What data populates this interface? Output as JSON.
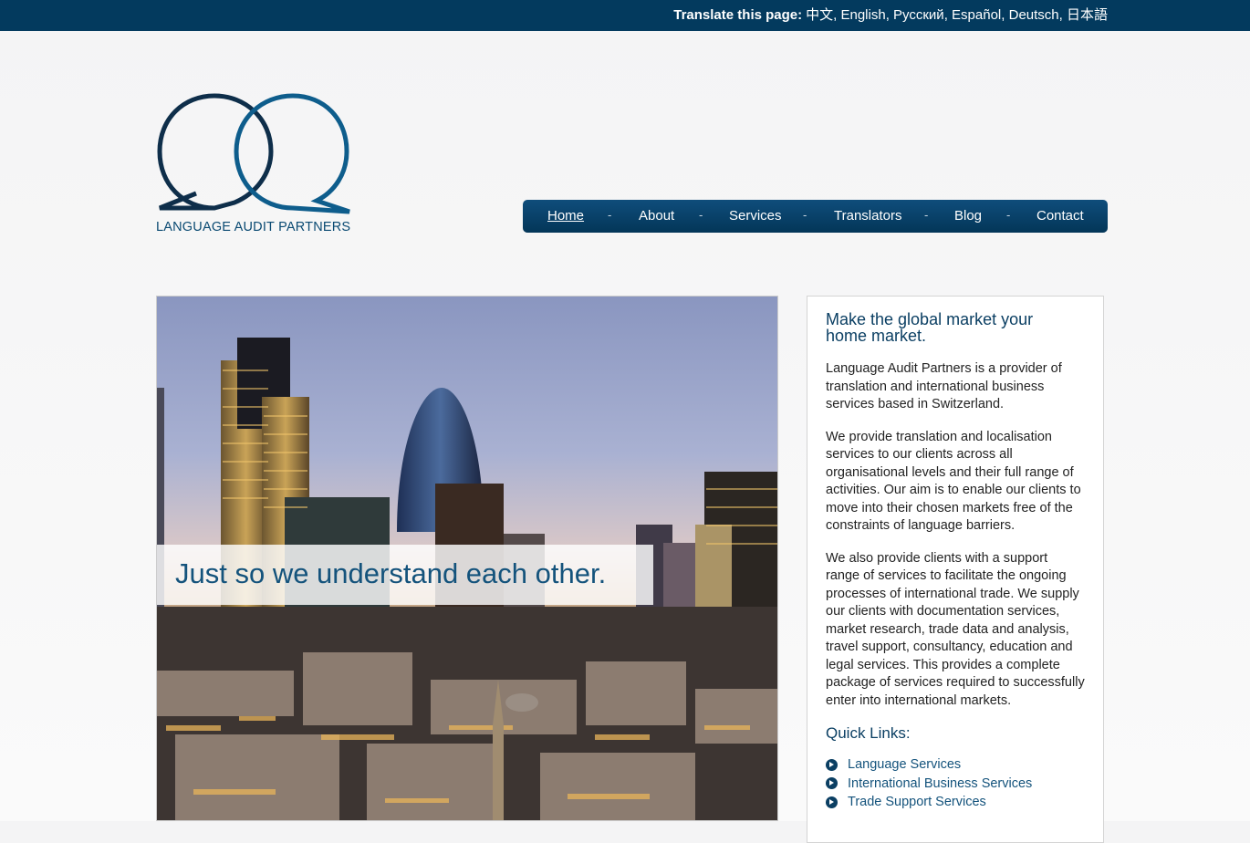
{
  "topbar": {
    "label": "Translate this page:",
    "languages": [
      "中文",
      "English",
      "Русский",
      "Español",
      "Deutsch",
      "日本語"
    ]
  },
  "logo": {
    "text": "LANGUAGE AUDIT PARTNERS"
  },
  "nav": {
    "items": [
      "Home",
      "About",
      "Services",
      "Translators",
      "Blog",
      "Contact"
    ],
    "active": "Home",
    "separator": "-"
  },
  "hero": {
    "tagline": "Just so we understand each other."
  },
  "sidebar": {
    "heading": "Make the global market your home market.",
    "paragraphs": [
      "Language Audit Partners is a provider of translation and international business services based in Switzerland.",
      "We provide translation and localisation services to our clients across all organisational levels and their full range of activities. Our aim is to enable our clients to move into their chosen markets free of the constraints of language barriers.",
      "We also provide clients with a support range of services to facilitate the ongoing processes of international trade. We supply our clients with documentation services, market research, trade data and analysis, travel support, consultancy, education and legal services. This provides a complete package of services required to successfully enter into international markets."
    ],
    "quick_links_title": "Quick Links:",
    "quick_links": [
      "Language Services",
      "International Business Services",
      "Trade Support Services"
    ]
  },
  "colors": {
    "topbar": "#033a5e",
    "nav": "#0a446e",
    "heading": "#0b3f63",
    "link": "#14537c"
  }
}
